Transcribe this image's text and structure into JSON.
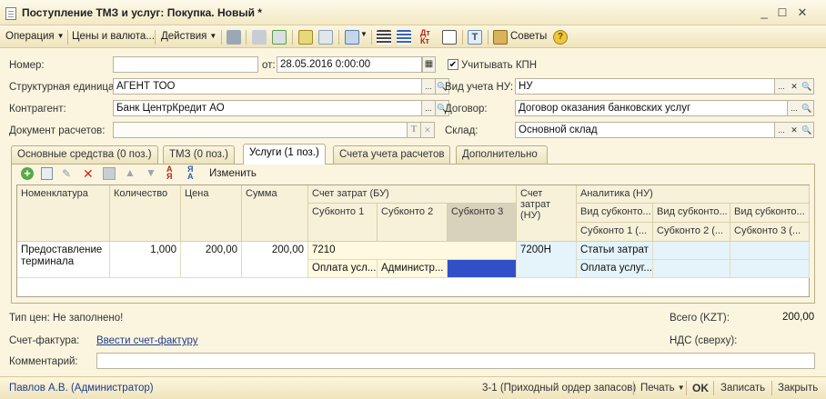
{
  "window": {
    "title": "Поступление ТМЗ и услуг: Покупка. Новый *"
  },
  "toolbar": {
    "operation": "Операция",
    "prices": "Цены и валюта...",
    "actions": "Действия",
    "tips": "Советы"
  },
  "form": {
    "number_label": "Номер:",
    "number_value": "",
    "from_label": "от:",
    "date_value": "28.05.2016  0:00:00",
    "kpn_label": "Учитывать КПН",
    "kpn_checked": "✔",
    "struct_unit_label": "Структурная единица:",
    "struct_unit_value": "АГЕНТ ТОО",
    "vid_ucheta_label": "Вид учета НУ:",
    "vid_ucheta_value": "НУ",
    "contragent_label": "Контрагент:",
    "contragent_value": "Банк ЦентрКредит АО",
    "dogovor_label": "Договор:",
    "dogovor_value": "Договор оказания банковских услуг",
    "doc_rasch_label": "Документ расчетов:",
    "doc_rasch_value": "",
    "sklad_label": "Склад:",
    "sklad_value": "Основной склад"
  },
  "tabs": [
    {
      "label": "Основные средства (0 поз.)"
    },
    {
      "label": "ТМЗ (0 поз.)"
    },
    {
      "label": "Услуги (1 поз.)"
    },
    {
      "label": "Счета учета расчетов"
    },
    {
      "label": "Дополнительно"
    }
  ],
  "grid_toolbar": {
    "edit_label": "Изменить"
  },
  "grid": {
    "headers": {
      "nomenklatura": "Номенклатура",
      "kolichestvo": "Количество",
      "cena": "Цена",
      "summa": "Сумма",
      "schet_zatrat_bu": "Счет затрат (БУ)",
      "subkonto1": "Субконто 1",
      "subkonto2": "Субконто 2",
      "subkonto3": "Субконто 3",
      "schet_zatrat_nu": "Счет затрат (НУ)",
      "analitika_nu": "Аналитика (НУ)",
      "vid_subkonto_a": "Вид субконто...",
      "vid_subkonto_b": "Вид субконто...",
      "vid_subkonto_c": "Вид субконто...",
      "subkonto1_nu": "Субконто 1 (...",
      "subkonto2_nu": "Субконто 2 (...",
      "subkonto3_nu": "Субконто 3 (..."
    },
    "row": {
      "nomenklatura": "Предоставление терминала",
      "kolichestvo": "1,000",
      "cena": "200,00",
      "summa": "200,00",
      "schet_bu": "7210",
      "subkonto1": "Оплата усл...",
      "subkonto2": "Администр...",
      "subkonto3": "",
      "schet_nu": "7200Н",
      "vid_subkonto1_nu": "Статьи затрат",
      "subkonto1_nu": "Оплата услуг..."
    }
  },
  "bottom": {
    "price_type": "Тип цен: Не заполнено!",
    "total_label": "Всего (KZT):",
    "total_value": "200,00",
    "invoice_label": "Счет-фактура:",
    "invoice_link": "Ввести счет-фактуру",
    "nds_label": "НДС (сверху):",
    "comment_label": "Комментарий:"
  },
  "footer": {
    "user": "Павлов А.В. (Администратор)",
    "order": "3-1 (Приходный ордер запасов)",
    "print": "Печать",
    "ok": "OK",
    "save": "Записать",
    "close": "Закрыть"
  },
  "colors": {
    "background": "#fbf5df",
    "selected_cell": "#3150c8",
    "row_highlight": "#fff9df",
    "nu_cells": "#e4f4fa"
  }
}
